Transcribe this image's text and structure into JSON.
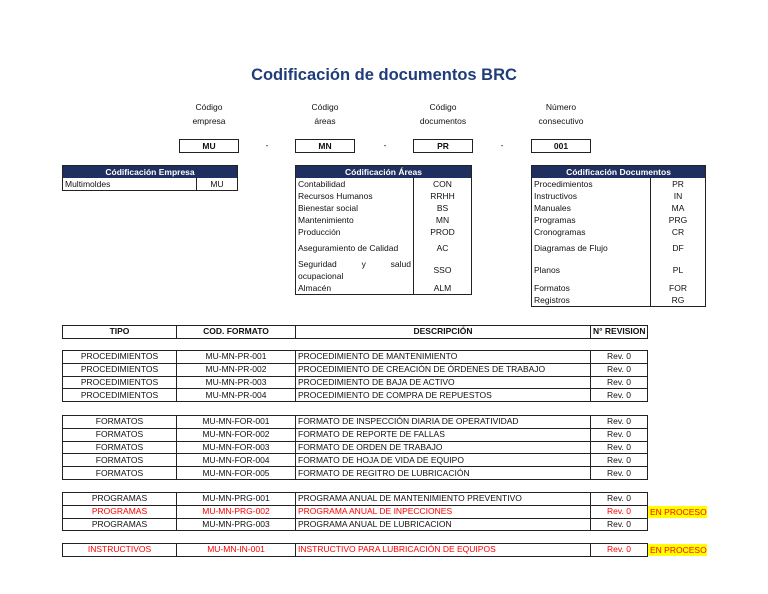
{
  "title": "Codificación de documentos BRC",
  "code_parts": [
    {
      "label1": "Código",
      "label2": "empresa",
      "value": "MU"
    },
    {
      "label1": "Código",
      "label2": "áreas",
      "value": "MN"
    },
    {
      "label1": "Código",
      "label2": "documentos",
      "value": "PR"
    },
    {
      "label1": "Número",
      "label2": "consecutivo",
      "value": "001"
    }
  ],
  "separator": "-",
  "empresa": {
    "header": "Códificación Empresa",
    "rows": [
      [
        "Multimoldes",
        "MU"
      ]
    ]
  },
  "areas": {
    "header": "Códificación Áreas",
    "rows": [
      [
        "Contabilidad",
        "CON"
      ],
      [
        "Recursos Humanos",
        "RRHH"
      ],
      [
        "Bienestar social",
        "BS"
      ],
      [
        "Mantenimiento",
        "MN"
      ],
      [
        "Producción",
        "PROD"
      ],
      [
        "Aseguramiento de Calidad",
        "AC"
      ],
      [
        "Seguridad y salud ocupacional",
        "SSO"
      ],
      [
        "Almacén",
        "ALM"
      ]
    ]
  },
  "documentos": {
    "header": "Códificación Documentos",
    "rows": [
      [
        "Procedimientos",
        "PR"
      ],
      [
        "Instructivos",
        "IN"
      ],
      [
        "Manuales",
        "MA"
      ],
      [
        "Programas",
        "PRG"
      ],
      [
        "Cronogramas",
        "CR"
      ],
      [
        "Diagramas de Flujo",
        "DF"
      ],
      [
        "Planos",
        "PL"
      ],
      [
        "Formatos",
        "FOR"
      ],
      [
        "Registros",
        "RG"
      ]
    ]
  },
  "main": {
    "headers": [
      "TIPO",
      "COD. FORMATO",
      "DESCRIPCIÓN",
      "N° REVISION"
    ],
    "groups": [
      [
        [
          "PROCEDIMIENTOS",
          "MU-MN-PR-001",
          "PROCEDIMIENTO DE MANTENIMIENTO",
          "Rev. 0",
          ""
        ],
        [
          "PROCEDIMIENTOS",
          "MU-MN-PR-002",
          "PROCEDIMIENTO DE CREACIÓN DE ÓRDENES DE TRABAJO",
          "Rev. 0",
          ""
        ],
        [
          "PROCEDIMIENTOS",
          "MU-MN-PR-003",
          "PROCEDIMIENTO DE BAJA DE ACTIVO",
          "Rev. 0",
          ""
        ],
        [
          "PROCEDIMIENTOS",
          "MU-MN-PR-004",
          "PROCEDIMIENTO DE COMPRA DE REPUESTOS",
          "Rev. 0",
          ""
        ]
      ],
      [
        [
          "FORMATOS",
          "MU-MN-FOR-001",
          "FORMATO DE INSPECCIÓN DIARIA DE OPERATIVIDAD",
          "Rev. 0",
          ""
        ],
        [
          "FORMATOS",
          "MU-MN-FOR-002",
          "FORMATO DE REPORTE DE FALLAS",
          "Rev. 0",
          ""
        ],
        [
          "FORMATOS",
          "MU-MN-FOR-003",
          "FORMATO DE ORDEN DE TRABAJO",
          "Rev. 0",
          ""
        ],
        [
          "FORMATOS",
          "MU-MN-FOR-004",
          "FORMATO DE HOJA DE VIDA DE EQUIPO",
          "Rev. 0",
          ""
        ],
        [
          "FORMATOS",
          "MU-MN-FOR-005",
          "FORMATO DE REGITRO DE LUBRICACIÓN",
          "Rev. 0",
          ""
        ]
      ],
      [
        [
          "PROGRAMAS",
          "MU-MN-PRG-001",
          "PROGRAMA ANUAL DE MANTENIMIENTO PREVENTIVO",
          "Rev. 0",
          ""
        ],
        [
          "PROGRAMAS",
          "MU-MN-PRG-002",
          "PROGRAMA ANUAL DE INPECCIONES",
          "Rev. 0",
          "EN PROCESO"
        ],
        [
          "PROGRAMAS",
          "MU-MN-PRG-003",
          "PROGRAMA ANUAL DE LUBRICACION",
          "Rev. 0",
          ""
        ]
      ],
      [
        [
          "INSTRUCTIVOS",
          "MU-MN-IN-001",
          "INSTRUCTIVO PARA LUBRICACIÓN DE EQUIPOS",
          "Rev. 0",
          "EN PROCESO"
        ]
      ]
    ]
  },
  "colors": {
    "header_bg": "#1f2f5f",
    "title": "#1f3d7a",
    "in_progress_text": "#ff0000",
    "in_progress_bg": "#ffff00"
  }
}
